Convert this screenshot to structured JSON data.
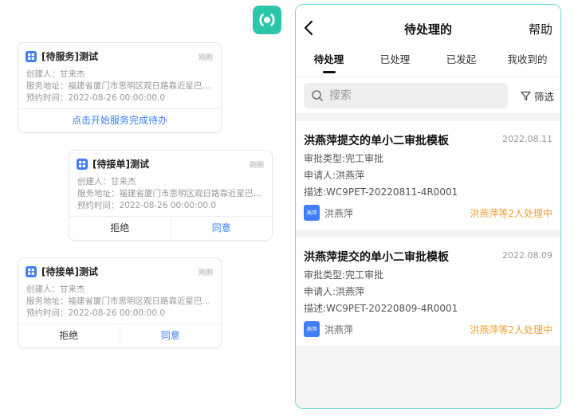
{
  "brand": {
    "logo_icon": "wave-circle-icon",
    "color": "#2cc7a8"
  },
  "left_cards": [
    {
      "title": "[待服务]测试",
      "time": "刚刚",
      "lines": [
        "创建人：甘来杰",
        "服务地址：福建省厦门市思明区观日路靠近星巴克...",
        "预约时间：2022-08-26 00:00:00.0"
      ],
      "action": "点击开始服务完成待办"
    },
    {
      "title": "[待接单]测试",
      "time": "刚刚",
      "lines": [
        "创建人：甘来杰",
        "服务地址：福建省厦门市思明区观日路靠近星巴克...",
        "预约时间：2022-08-26 00:00:00.0"
      ],
      "reject": "拒绝",
      "agree": "同意"
    },
    {
      "title": "[待接单]测试",
      "time": "刚刚",
      "lines": [
        "创建人：甘来杰",
        "服务地址：福建省厦门市思明区观日路靠近星巴克...",
        "预约时间：2022-08-26 00:00:00.0"
      ],
      "reject": "拒绝",
      "agree": "同意"
    }
  ],
  "phone": {
    "nav": {
      "back_icon": "chevron-left-icon",
      "title": "待处理的",
      "help": "帮助"
    },
    "tabs": [
      {
        "label": "待处理",
        "active": true
      },
      {
        "label": "已处理",
        "active": false
      },
      {
        "label": "已发起",
        "active": false
      },
      {
        "label": "我收到的",
        "active": false
      }
    ],
    "search": {
      "placeholder": "搜索",
      "icon": "search-icon"
    },
    "filter": {
      "label": "筛选",
      "icon": "funnel-icon"
    },
    "items": [
      {
        "title": "洪燕萍提交的单小二审批模板",
        "date": "2022.08.11",
        "type": "审批类型:完工审批",
        "applicant": "申请人:洪燕萍",
        "desc": "描述:WC9PET-20220811-4R0001",
        "avatar_text": "燕萍",
        "person": "洪燕萍",
        "status": "洪燕萍等2人处理中"
      },
      {
        "title": "洪燕萍提交的单小二审批模板",
        "date": "2022.08.09",
        "type": "审批类型:完工审批",
        "applicant": "申请人:洪燕萍",
        "desc": "描述:WC9PET-20220809-4R0001",
        "avatar_text": "燕萍",
        "person": "洪燕萍",
        "status": "洪燕萍等2人处理中"
      }
    ]
  },
  "colors": {
    "accent_blue": "#3f7ef5",
    "status_orange": "#f0a030",
    "panel_border": "#6fdad2"
  }
}
